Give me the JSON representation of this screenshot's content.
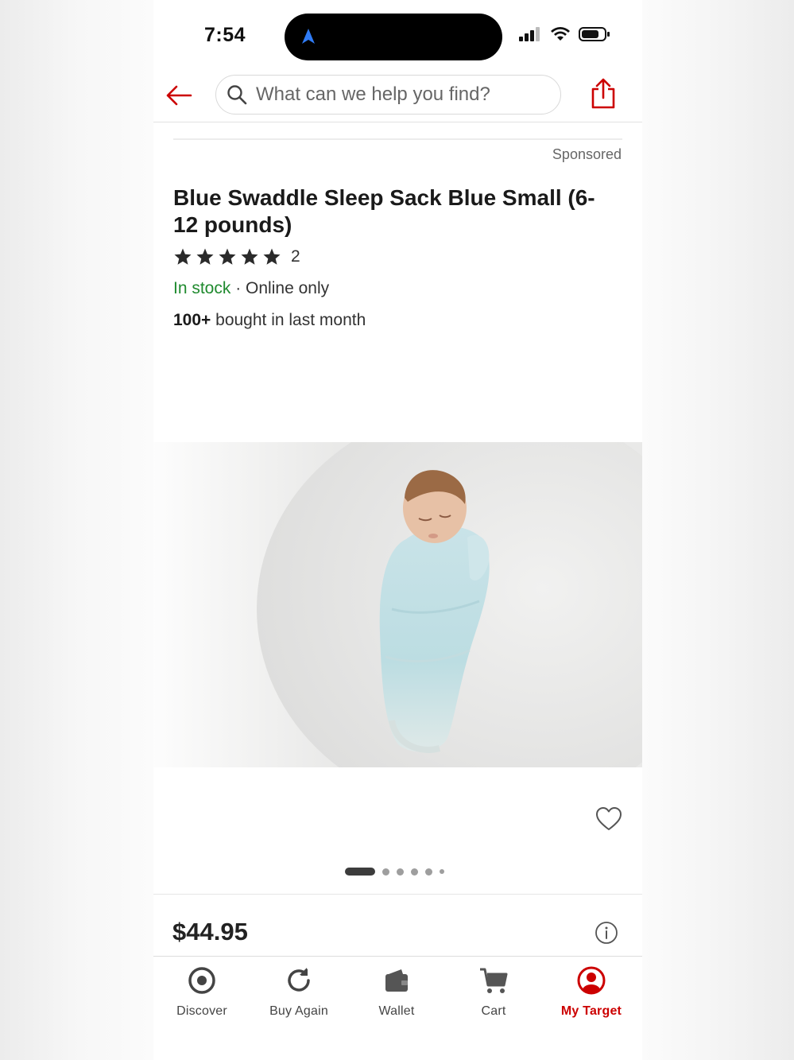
{
  "status_bar": {
    "time": "7:54",
    "icons": [
      "navigation-arrow-icon",
      "cellular-signal-icon",
      "wifi-icon",
      "battery-icon"
    ]
  },
  "header": {
    "back_icon": "back-arrow-icon",
    "search_placeholder": "What can we help you find?",
    "search_icon": "search-icon",
    "share_icon": "share-icon"
  },
  "product": {
    "sponsored_label": "Sponsored",
    "title": "Blue Swaddle Sleep Sack Blue Small (6-12 pounds)",
    "rating_stars": 5,
    "rating_count": "2",
    "in_stock": "In stock",
    "availability_separator": " · ",
    "availability_note": "Online only",
    "bought_count": "100+",
    "bought_text": " bought in last month",
    "price": "$44.95",
    "image_alt": "Baby sleeping in light blue knit swaddle sleep sack on white blanket",
    "carousel": {
      "total": 6,
      "active_index": 0
    }
  },
  "tab_bar": {
    "items": [
      {
        "label": "Discover",
        "icon": "target-bullseye-icon",
        "active": false
      },
      {
        "label": "Buy Again",
        "icon": "refresh-icon",
        "active": false
      },
      {
        "label": "Wallet",
        "icon": "wallet-icon",
        "active": false
      },
      {
        "label": "Cart",
        "icon": "cart-icon",
        "active": false
      },
      {
        "label": "My Target",
        "icon": "user-circle-icon",
        "active": true
      }
    ]
  },
  "colors": {
    "brand_red": "#cc0000",
    "in_stock_green": "#1f8a2e",
    "text_dark": "#222222"
  }
}
